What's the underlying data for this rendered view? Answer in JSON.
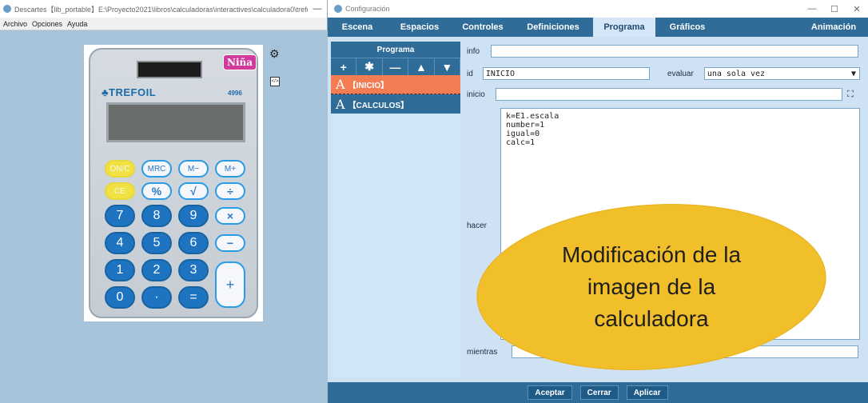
{
  "left_window": {
    "title": "Descartes【lib_portable】E:\\Proyecto2021\\libros\\calculadoras\\interactives\\calculadora0\\trefoil...",
    "min_label": "—",
    "menu": [
      "Archivo",
      "Opciones",
      "Ayuda"
    ]
  },
  "calculator": {
    "badge": "Niña",
    "brand": "TREFOIL",
    "model": "4996",
    "keys": {
      "row1": [
        "ON/C",
        "MRC",
        "M−",
        "M+"
      ],
      "row2": [
        "CE",
        "%",
        "√",
        "÷"
      ],
      "row3": [
        "7",
        "8",
        "9",
        "×"
      ],
      "row4": [
        "4",
        "5",
        "6",
        "−"
      ],
      "row5": [
        "1",
        "2",
        "3"
      ],
      "row6": [
        "0",
        "·",
        "="
      ],
      "plus": "+"
    }
  },
  "right_window": {
    "title": "Configuración",
    "controls": [
      "—",
      "☐",
      "✕"
    ]
  },
  "tabs": [
    {
      "label": "Escena"
    },
    {
      "label": "Espacios"
    },
    {
      "label": "Controles"
    },
    {
      "label": "Definiciones"
    },
    {
      "label": "Programa",
      "active": true
    },
    {
      "label": "Gráficos"
    },
    {
      "label": "Animación"
    }
  ],
  "program_panel": {
    "header": "Programa",
    "toolbar": [
      "+",
      "✱",
      "—",
      "▲",
      "▼"
    ],
    "items": [
      {
        "glyph": "A",
        "label": "【INICIO】",
        "selected": true
      },
      {
        "glyph": "A",
        "label": "【CALCULOS】",
        "selected": false
      }
    ]
  },
  "form": {
    "info_label": "info",
    "info_value": "",
    "id_label": "id",
    "id_value": "INICIO",
    "evaluar_label": "evaluar",
    "evaluar_value": "una sola vez",
    "inicio_label": "inicio",
    "inicio_value": "",
    "hacer_label": "hacer",
    "hacer_value": "k=E1.escala\nnumber=1\nigual=0\ncalc=1",
    "mientras_label": "mientras",
    "mientras_value": ""
  },
  "bottom_buttons": [
    "Aceptar",
    "Cerrar",
    "Aplicar"
  ],
  "callout": {
    "text": "Modificación de la imagen de la calculadora",
    "color": "#f1bf2a"
  },
  "colors": {
    "accent": "#2f6c98",
    "selected_item": "#f27d52",
    "canvas_bg": "#a7c3da"
  }
}
